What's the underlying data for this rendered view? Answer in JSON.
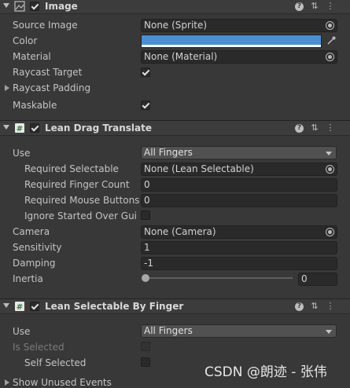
{
  "components": {
    "image": {
      "title": "Image",
      "enabled": true,
      "fields": {
        "source_image": {
          "label": "Source Image",
          "value": "None (Sprite)"
        },
        "color": {
          "label": "Color",
          "value": "#4a8fd6"
        },
        "material": {
          "label": "Material",
          "value": "None (Material)"
        },
        "raycast_target": {
          "label": "Raycast Target",
          "checked": true
        },
        "raycast_padding": {
          "label": "Raycast Padding"
        },
        "maskable": {
          "label": "Maskable",
          "checked": true
        }
      }
    },
    "drag": {
      "title": "Lean Drag Translate",
      "enabled": true,
      "fields": {
        "use": {
          "label": "Use",
          "value": "All Fingers"
        },
        "required_selectable": {
          "label": "Required Selectable",
          "value": "None (Lean Selectable)"
        },
        "required_finger_count": {
          "label": "Required Finger Count",
          "value": "0"
        },
        "required_mouse_buttons": {
          "label": "Required Mouse Buttons",
          "value": "0"
        },
        "ignore_started": {
          "label": "Ignore Started Over Gui",
          "checked": false
        },
        "camera": {
          "label": "Camera",
          "value": "None (Camera)"
        },
        "sensitivity": {
          "label": "Sensitivity",
          "value": "1"
        },
        "damping": {
          "label": "Damping",
          "value": "-1"
        },
        "inertia": {
          "label": "Inertia",
          "value": "0",
          "slider_fraction": 0
        }
      }
    },
    "selectable": {
      "title": "Lean Selectable By Finger",
      "enabled": true,
      "fields": {
        "use": {
          "label": "Use",
          "value": "All Fingers"
        },
        "is_selected": {
          "label": "Is Selected",
          "checked": false
        },
        "self_selected": {
          "label": "Self Selected",
          "checked": false
        },
        "show_unused": {
          "label": "Show Unused Events"
        }
      }
    }
  },
  "watermark": "CSDN @朗迹 - 张伟",
  "colors": {
    "background": "#383838",
    "header": "#3c3c3c",
    "accent": "#4a8fd6"
  }
}
